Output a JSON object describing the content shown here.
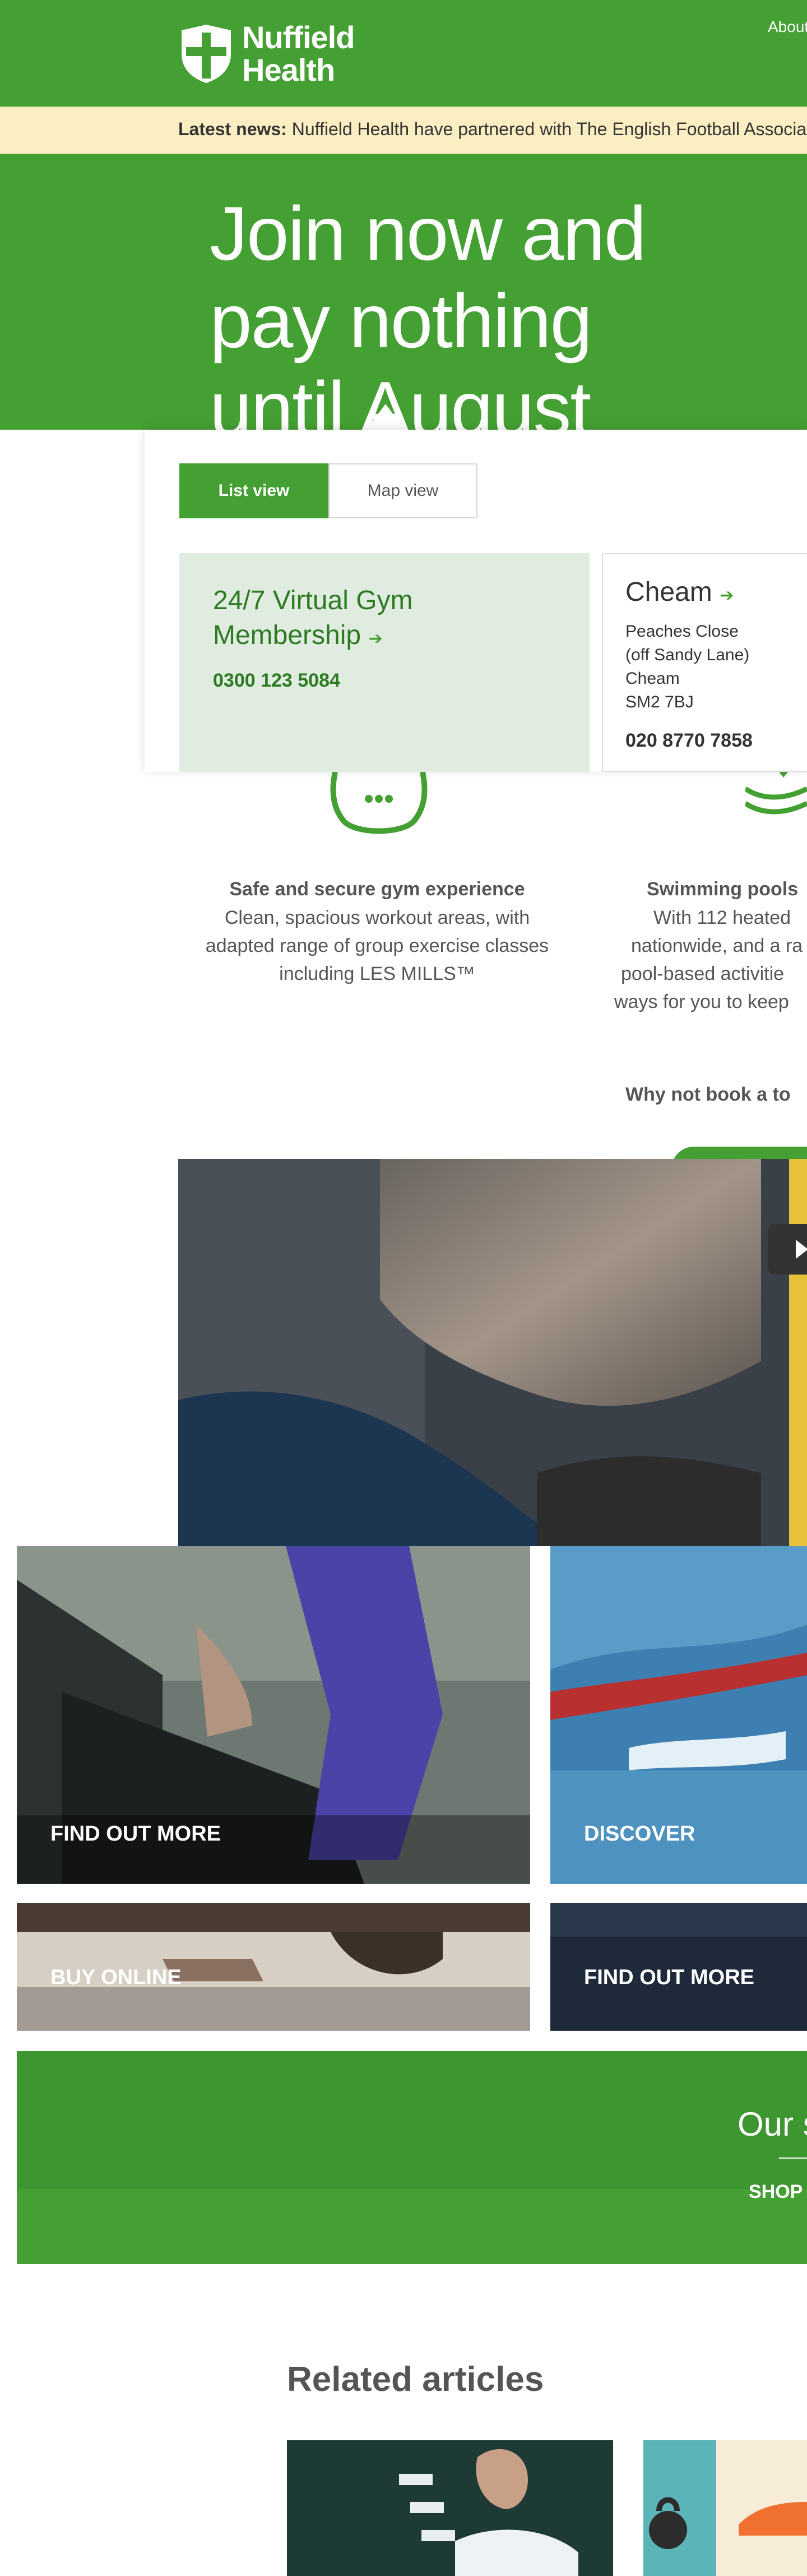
{
  "header": {
    "logo_line1": "Nuffield",
    "logo_line2": "Health",
    "nav_about": "About"
  },
  "newsbar": {
    "label": "Latest news:",
    "text": "Nuffield Health have partnered with The English Football Association"
  },
  "hero": {
    "line1": "Join now and",
    "line2": "pay nothing",
    "line3": "until August"
  },
  "finder": {
    "list_view": "List view",
    "map_view": "Map view",
    "virtual": {
      "title_line1": "24/7 Virtual Gym",
      "title_line2": "Membership",
      "phone": "0300 123 5084"
    },
    "cheam": {
      "title": "Cheam",
      "addr1": "Peaches Close",
      "addr2": "(off Sandy Lane)",
      "addr3": "Cheam",
      "addr4": "SM2 7BJ",
      "phone": "020 8770 7858"
    }
  },
  "features": {
    "safe": {
      "title": "Safe and secure gym experience",
      "line1": "Clean, spacious workout areas, with",
      "line2": "adapted range of group exercise classes",
      "line3": "including LES MILLS™"
    },
    "pools": {
      "title": "Swimming pools",
      "line1": "With 112 heated",
      "line2": "nationwide, and a ra",
      "line3": "pool-based activitie",
      "line4": "ways for you to keep"
    }
  },
  "tour": "Why not book a to",
  "tiles": {
    "find_out_more_1": "FIND OUT MORE",
    "discover": "DISCOVER",
    "buy_online": "BUY ONLINE",
    "find_out_more_2": "FIND OUT MORE"
  },
  "promo": {
    "title": "Our s",
    "shop": "SHOP"
  },
  "related": {
    "title": "Related articles"
  },
  "colors": {
    "brand_green": "#44a032",
    "news_bg": "#fbeec3",
    "virtual_card_bg": "#e0ece0"
  }
}
